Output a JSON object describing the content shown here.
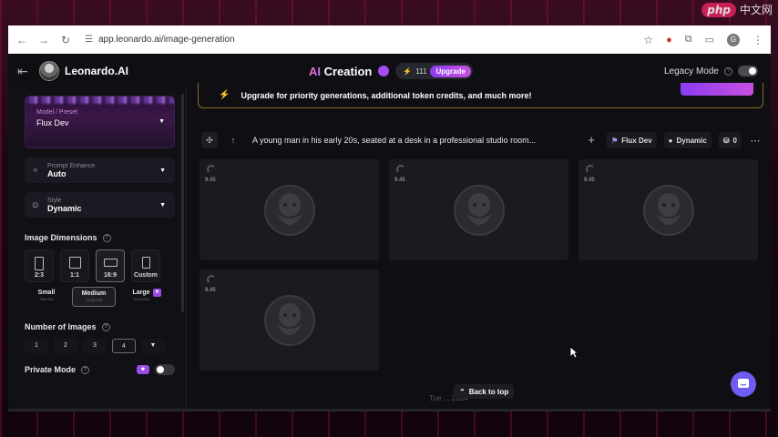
{
  "browser": {
    "url": "app.leonardo.ai/image-generation",
    "avatar_initial": "G"
  },
  "watermark": {
    "badge": "php",
    "text": "中文网"
  },
  "header": {
    "brand": "Leonardo.AI",
    "title_ai": "AI",
    "title_rest": " Creation",
    "credits": "111",
    "upgrade_label": "Upgrade",
    "legacy_mode_label": "Legacy Mode"
  },
  "sidebar": {
    "model": {
      "label": "Model / Preset",
      "value": "Flux Dev"
    },
    "prompt_enhance": {
      "label": "Prompt Enhance",
      "value": "Auto"
    },
    "style": {
      "label": "Style",
      "value": "Dynamic"
    },
    "image_dimensions_title": "Image Dimensions",
    "ratios": [
      {
        "label": "2:3"
      },
      {
        "label": "1:1"
      },
      {
        "label": "16:9"
      },
      {
        "label": "Custom"
      }
    ],
    "sizes": [
      {
        "label": "Small",
        "sub": "768×432"
      },
      {
        "label": "Medium",
        "sub": "1376×768"
      },
      {
        "label": "Large",
        "sub": "1472×832"
      }
    ],
    "number_of_images_title": "Number of Images",
    "counts": [
      "1",
      "2",
      "3",
      "4"
    ],
    "private_mode_label": "Private Mode"
  },
  "main": {
    "banner_text": "Upgrade for priority generations, additional token credits, and much more!",
    "prompt": "A young man in his early 20s, seated at a desk in a professional studio room...",
    "chip_model": "Flux Dev",
    "chip_style": "Dynamic",
    "chip_count": "0",
    "tiles": [
      {
        "time": "9.45"
      },
      {
        "time": "9.45"
      },
      {
        "time": "9.45"
      },
      {
        "time": "9.45"
      }
    ],
    "back_to_top": "Back to top",
    "ghost_date": "Tue ... 2024"
  }
}
